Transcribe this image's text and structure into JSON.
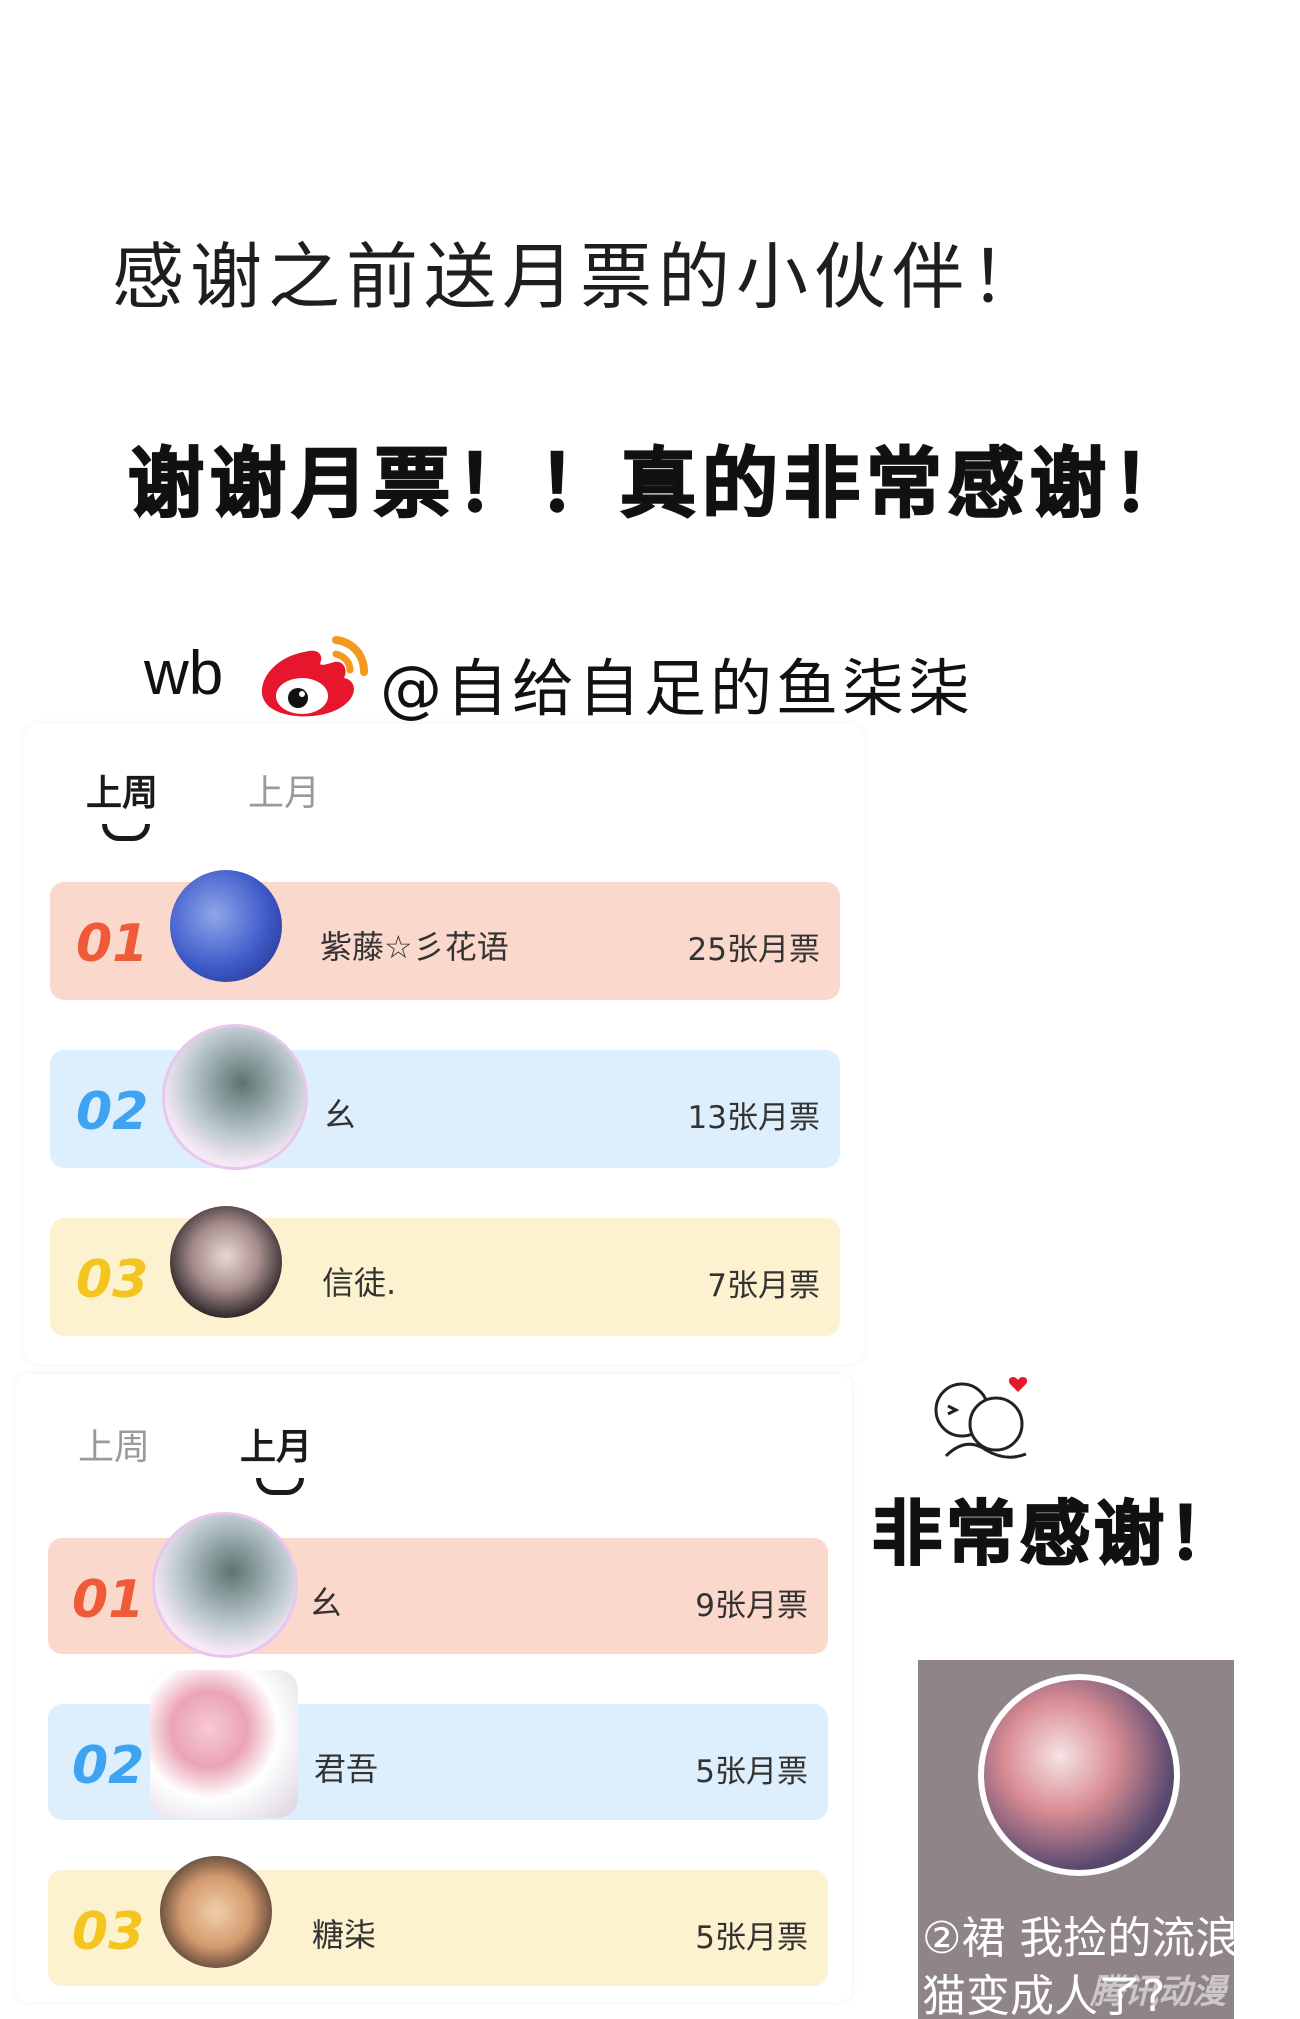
{
  "header": {
    "title": "感谢之前送月票的小伙伴！",
    "bold_thanks": "谢谢月票！！真的非常感谢！",
    "wb_prefix": "wb",
    "weibo_handle": "@自给自足的鱼柒柒"
  },
  "weekly_panel": {
    "tab_week": "上周",
    "tab_month": "上月",
    "active_tab": "上周",
    "rows": [
      {
        "rank": "01",
        "name": "紫藤☆彡花语",
        "votes": "25张月票"
      },
      {
        "rank": "02",
        "name": "幺",
        "votes": "13张月票"
      },
      {
        "rank": "03",
        "name": "信徒.",
        "votes": "7张月票"
      }
    ]
  },
  "monthly_panel": {
    "tab_week": "上周",
    "tab_month": "上月",
    "active_tab": "上月",
    "rows": [
      {
        "rank": "01",
        "name": "幺",
        "votes": "9张月票"
      },
      {
        "rank": "02",
        "name": "君吾",
        "votes": "5张月票"
      },
      {
        "rank": "03",
        "name": "糖柒",
        "votes": "5张月票"
      }
    ]
  },
  "side": {
    "thanks_text": "非常感谢！",
    "cover_caption": "②裙 我捡的流浪猫变成人了?",
    "watermark": "腾讯动漫"
  },
  "colors": {
    "rank1": "#ef5a38",
    "rank2": "#3ea3f0",
    "rank3": "#f5c51f",
    "row1_bg": "#fbd8cc",
    "row2_bg": "#ddeefc",
    "row3_bg": "#fdf2cf",
    "weibo_red": "#e6162d",
    "weibo_orange": "#f39a1e"
  }
}
